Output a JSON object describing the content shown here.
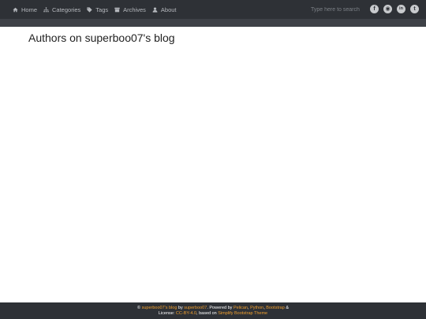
{
  "nav": {
    "items": [
      {
        "label": "Home",
        "icon": "home-icon"
      },
      {
        "label": "Categories",
        "icon": "categories-icon"
      },
      {
        "label": "Tags",
        "icon": "tag-icon"
      },
      {
        "label": "Archives",
        "icon": "archive-icon"
      },
      {
        "label": "About",
        "icon": "user-icon"
      }
    ],
    "search_placeholder": "Type here to search",
    "social": [
      {
        "name": "facebook-icon",
        "glyph": "f"
      },
      {
        "name": "github-icon",
        "glyph": "◉"
      },
      {
        "name": "linkedin-icon",
        "glyph": "in"
      },
      {
        "name": "twitter-icon",
        "glyph": "t"
      }
    ]
  },
  "main": {
    "title": "Authors on superboo07's blog"
  },
  "footer": {
    "copyright": "©",
    "blog_link": "superboo07's blog",
    "by": "by",
    "author_link": "superboo07",
    "powered_by": ". Powered by",
    "pelican": "Pelican",
    "comma1": ",",
    "python": "Python",
    "comma2": ",",
    "bootstrap": "Bootstrap",
    "amp": "&",
    "license_label": "License:",
    "license_link": "CC-BY-4.0",
    "based_on": ", based on",
    "theme_link": "Simplify Bootstrap Theme"
  },
  "colors": {
    "navbar": "#2e3136",
    "subbar": "#3e4147",
    "link_accent": "#f0a030"
  }
}
